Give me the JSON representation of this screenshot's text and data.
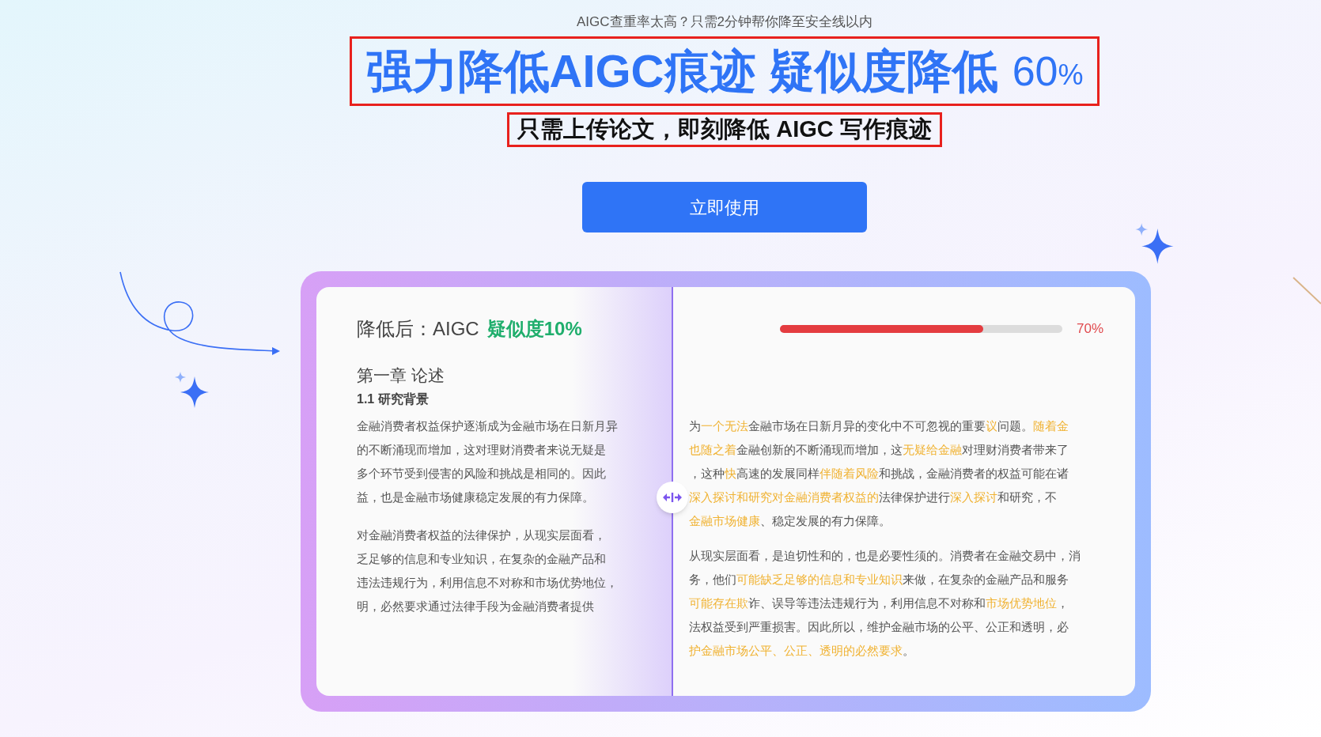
{
  "tagline": "AIGC查重率太高？只需2分钟帮你降至安全线以内",
  "headline": {
    "text": "强力降低AIGC痕迹 疑似度降低",
    "number": "60",
    "unit": "%"
  },
  "subheadline": "只需上传论文，即刻降低 AIGC 写作痕迹",
  "cta_button": "立即使用",
  "comparison": {
    "after": {
      "label": "降低后：AIGC",
      "score": "疑似度10%",
      "chapter": "第一章 论述",
      "section": "1.1 研究背景",
      "paragraphs": [
        [
          "金融消费者权益保护逐渐成为金融市场在日新月异",
          "的不断涌现而增加，这对理财消费者来说无疑是",
          "多个环节受到侵害的风险和挑战是相同的。因此",
          "益，也是金融市场健康稳定发展的有力保障。"
        ],
        [
          "对金融消费者权益的法律保护，从现实层面看，",
          "乏足够的信息和专业知识，在复杂的金融产品和",
          "违法违规行为，利用信息不对称和市场优势地位，",
          "明，必然要求通过法律手段为金融消费者提供"
        ]
      ]
    },
    "before": {
      "meter": {
        "level": 0.72,
        "reading": "70%"
      },
      "paragraphs": [
        [
          [
            {
              "text": "为",
              "highlighted": false
            },
            {
              "text": "一个无法",
              "highlighted": true
            },
            {
              "text": "金融市场在日新月异的变化中不可忽视的重要",
              "highlighted": false
            },
            {
              "text": "议",
              "highlighted": true
            },
            {
              "text": "问题。",
              "highlighted": false
            },
            {
              "text": "随着金",
              "highlighted": true
            }
          ],
          [
            {
              "text": "也随之着",
              "highlighted": true
            },
            {
              "text": "金融创新的不断涌现而增加，这",
              "highlighted": false
            },
            {
              "text": "无疑给金融",
              "highlighted": true
            },
            {
              "text": "对理财消费者带来了",
              "highlighted": false
            }
          ],
          [
            {
              "text": "，这种",
              "highlighted": false
            },
            {
              "text": "快",
              "highlighted": true
            },
            {
              "text": "高速的发展同样",
              "highlighted": false
            },
            {
              "text": "伴随着风险",
              "highlighted": true
            },
            {
              "text": "和挑战，金融消费者的权益可能在诸",
              "highlighted": false
            }
          ],
          [
            {
              "text": "深入探讨和研究对金融消费者权益的",
              "highlighted": true
            },
            {
              "text": "法律保护进行",
              "highlighted": false
            },
            {
              "text": "深入探讨",
              "highlighted": true
            },
            {
              "text": "和研究，不",
              "highlighted": false
            }
          ],
          [
            {
              "text": "金融市场健康",
              "highlighted": true
            },
            {
              "text": "、稳定发展的有力保障。",
              "highlighted": false
            }
          ]
        ],
        [
          [
            {
              "text": "从现实层面看，是迫切性和的，也是必要性须的。消费者在金融交易中，消",
              "highlighted": false
            }
          ],
          [
            {
              "text": "务，他们",
              "highlighted": false
            },
            {
              "text": "可能缺乏足够的信息和专业知识",
              "highlighted": true
            },
            {
              "text": "来做，在复杂的金融产品和服务",
              "highlighted": false
            }
          ],
          [
            {
              "text": "可能存在欺",
              "highlighted": true
            },
            {
              "text": "诈、误导等违法违规行为，利用信息不对称和",
              "highlighted": false
            },
            {
              "text": "市场优势地位",
              "highlighted": true
            },
            {
              "text": "，",
              "highlighted": false
            }
          ],
          [
            {
              "text": "法权益受到严重损害。因此所以，维护金融市场的公平、公正和透明，必",
              "highlighted": false
            }
          ],
          [
            {
              "text": "护金融市场公平、公正、透明的必然要求",
              "highlighted": true
            },
            {
              "text": "。",
              "highlighted": false
            }
          ]
        ]
      ]
    }
  }
}
